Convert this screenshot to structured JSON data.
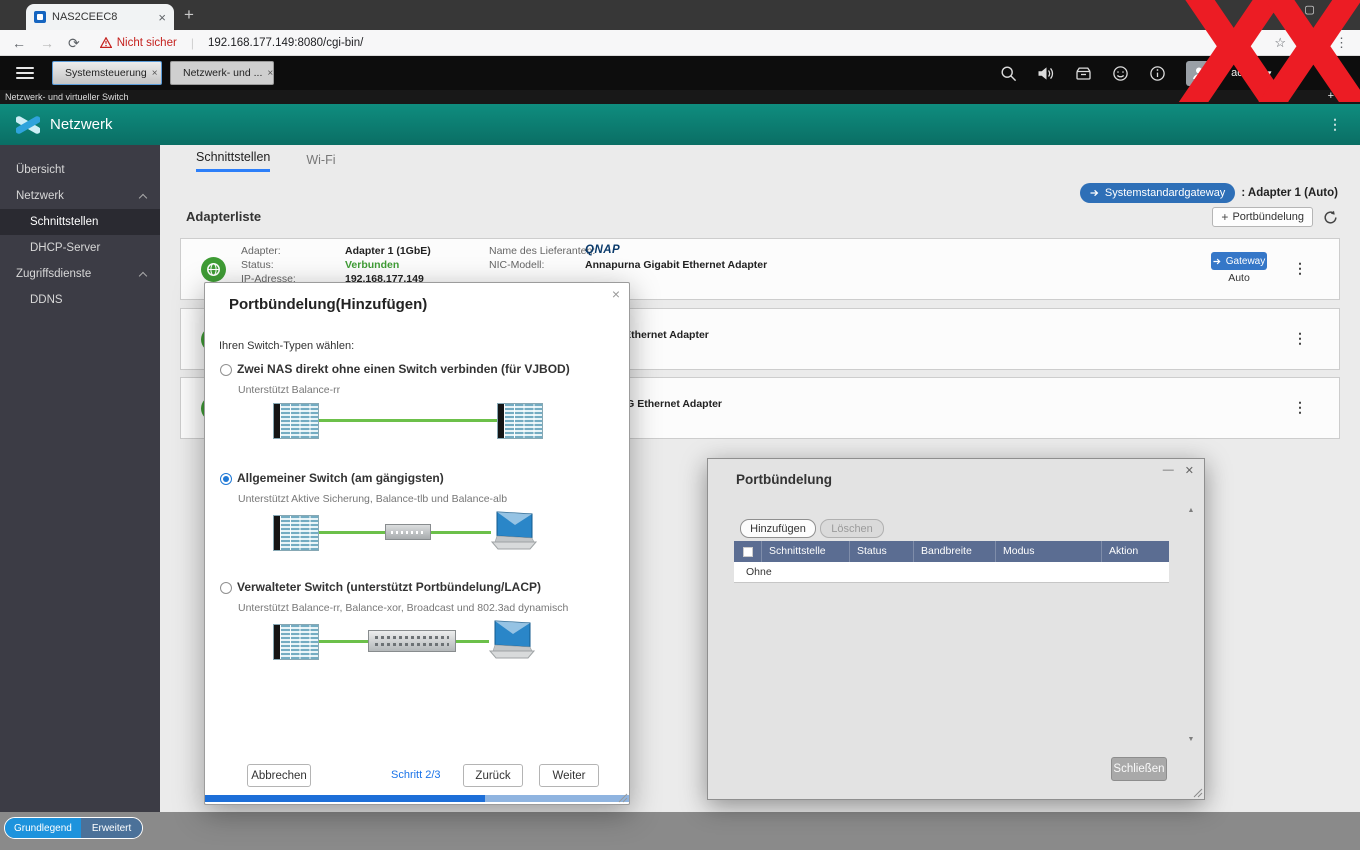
{
  "colors": {
    "accent_blue": "#2d7ff9",
    "header_teal": "#0b7f73",
    "status_green": "#3f9c35",
    "table_header_blue": "#5b6d92",
    "watermark_red": "#ec1c24"
  },
  "browser": {
    "tab_title": "NAS2CEEC8",
    "security_label": "Nicht sicher",
    "url": "192.168.177.149:8080/cgi-bin/"
  },
  "taskbar": {
    "tabs": [
      {
        "label": "Systemsteuerung"
      },
      {
        "label": "Netzwerk- und ..."
      }
    ],
    "user_label": "admin"
  },
  "window": {
    "strip_title": "Netzwerk- und virtueller Switch",
    "app_title": "Netzwerk"
  },
  "sidebar": {
    "items": [
      {
        "label": "Übersicht"
      },
      {
        "label": "Netzwerk"
      },
      {
        "label": "Schnittstellen"
      },
      {
        "label": "DHCP-Server"
      },
      {
        "label": "Zugriffsdienste"
      },
      {
        "label": "DDNS"
      }
    ]
  },
  "content": {
    "tabs": [
      {
        "label": "Schnittstellen"
      },
      {
        "label": "Wi-Fi"
      }
    ],
    "gateway_pill": "Systemstandardgateway",
    "gateway_value": ": Adapter 1 (Auto)",
    "list_title": "Adapterliste",
    "add_trunk_button": "Portbündelung",
    "adapter1": {
      "label_adapter": "Adapter:",
      "value_adapter": "Adapter 1 (1GbE)",
      "label_status": "Status:",
      "value_status": "Verbunden",
      "label_ip": "IP-Adresse:",
      "value_ip": "192.168.177.149",
      "label_vendor": "Name des Lieferanten:",
      "value_vendor": "QNAP",
      "label_nic": "NIC-Modell:",
      "value_nic": "Annapurna Gigabit Ethernet Adapter",
      "gateway_button": "Gateway",
      "gateway_mode": "Auto"
    },
    "adapter2": {
      "value_nic": "Gigabit Ethernet Adapter"
    },
    "adapter3": {
      "value_nic": "SFP+ 10G Ethernet Adapter"
    }
  },
  "modal": {
    "title": "Portbündelung(Hinzufügen)",
    "prompt": "Ihren Switch-Typen wählen:",
    "options": [
      {
        "label": "Zwei NAS direkt ohne einen Switch verbinden (für VJBOD)",
        "sub": "Unterstützt Balance-rr",
        "selected": false
      },
      {
        "label": "Allgemeiner Switch (am gängigsten)",
        "sub": "Unterstützt Aktive Sicherung, Balance-tlb und Balance-alb",
        "selected": true
      },
      {
        "label": "Verwalteter Switch (unterstützt Portbündelung/LACP)",
        "sub": "Unterstützt Balance-rr, Balance-xor, Broadcast und 802.3ad dynamisch",
        "selected": false
      }
    ],
    "cancel": "Abbrechen",
    "step_label": "Schritt 2/3",
    "back": "Zurück",
    "next": "Weiter",
    "progress_percent": 66
  },
  "trunk_window": {
    "title": "Portbündelung",
    "add_button": "Hinzufügen",
    "delete_button": "Löschen",
    "columns": [
      "Schnittstelle",
      "Status",
      "Bandbreite",
      "Modus",
      "Aktion"
    ],
    "rows": [
      {
        "interface": "Ohne"
      }
    ],
    "close_button": "Schließen"
  },
  "footer": {
    "basic": "Grundlegend",
    "advanced": "Erweitert"
  },
  "watermark": {
    "text": "XX"
  }
}
